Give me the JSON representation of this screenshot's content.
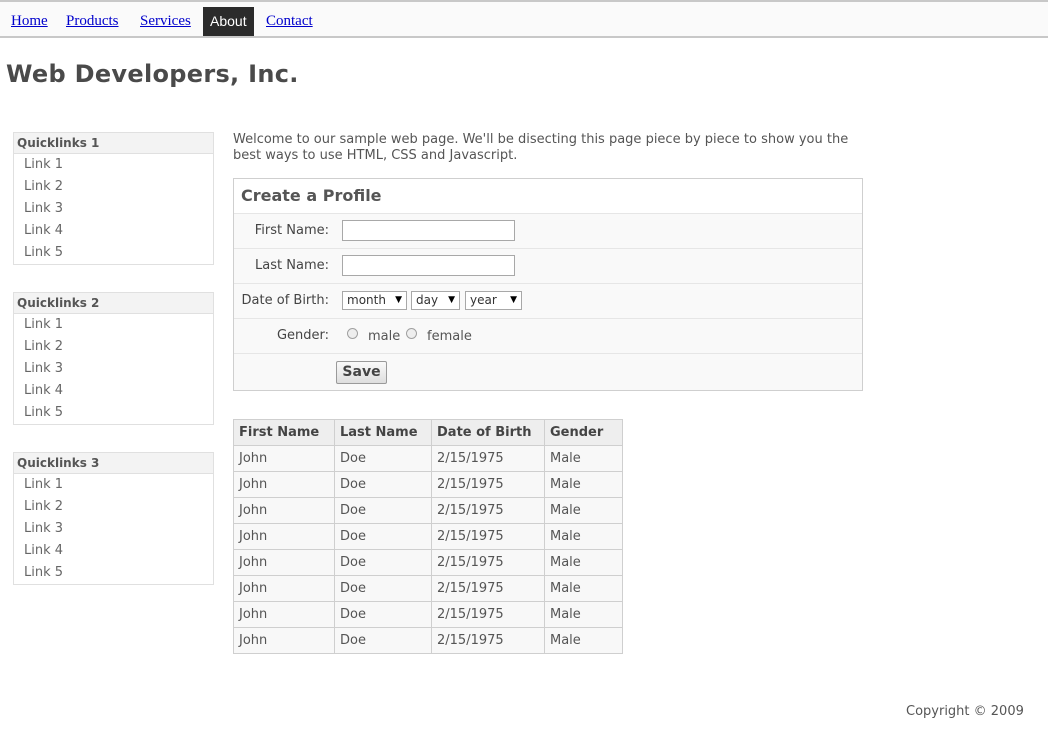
{
  "nav": {
    "items": [
      {
        "label": "Home",
        "active": false
      },
      {
        "label": "Products",
        "active": false
      },
      {
        "label": "Services",
        "active": false
      },
      {
        "label": "About",
        "active": true
      },
      {
        "label": "Contact",
        "active": false
      }
    ]
  },
  "site_title": "Web Developers, Inc.",
  "quicklinks": [
    {
      "title": "Quicklinks 1",
      "links": [
        "Link 1",
        "Link 2",
        "Link 3",
        "Link 4",
        "Link 5"
      ]
    },
    {
      "title": "Quicklinks 2",
      "links": [
        "Link 1",
        "Link 2",
        "Link 3",
        "Link 4",
        "Link 5"
      ]
    },
    {
      "title": "Quicklinks 3",
      "links": [
        "Link 1",
        "Link 2",
        "Link 3",
        "Link 4",
        "Link 5"
      ]
    }
  ],
  "intro": "Welcome to our sample web page. We'll be disecting this page piece by piece to show you the best ways to use HTML, CSS and Javascript.",
  "form": {
    "title": "Create a Profile",
    "first_name_label": "First Name:",
    "first_name_value": "",
    "last_name_label": "Last Name:",
    "last_name_value": "",
    "dob_label": "Date of Birth:",
    "month_selected": "month",
    "day_selected": "day",
    "year_selected": "year",
    "gender_label": "Gender:",
    "gender_options": [
      "male",
      "female"
    ],
    "save_label": "Save"
  },
  "table": {
    "headers": [
      "First Name",
      "Last Name",
      "Date of Birth",
      "Gender"
    ],
    "rows": [
      [
        "John",
        "Doe",
        "2/15/1975",
        "Male"
      ],
      [
        "John",
        "Doe",
        "2/15/1975",
        "Male"
      ],
      [
        "John",
        "Doe",
        "2/15/1975",
        "Male"
      ],
      [
        "John",
        "Doe",
        "2/15/1975",
        "Male"
      ],
      [
        "John",
        "Doe",
        "2/15/1975",
        "Male"
      ],
      [
        "John",
        "Doe",
        "2/15/1975",
        "Male"
      ],
      [
        "John",
        "Doe",
        "2/15/1975",
        "Male"
      ],
      [
        "John",
        "Doe",
        "2/15/1975",
        "Male"
      ]
    ]
  },
  "footer": "Copyright © 2009",
  "colors": {
    "link": "#0000cc",
    "nav_active_bg": "#2b2b2b",
    "text": "#555555"
  }
}
